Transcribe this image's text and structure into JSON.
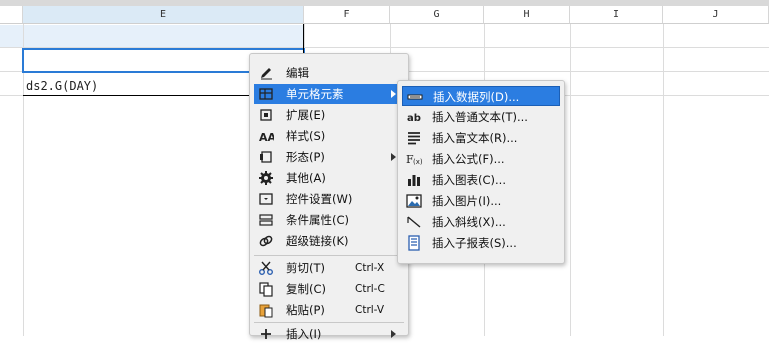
{
  "sheet": {
    "columns": [
      "E",
      "F",
      "G",
      "H",
      "I",
      "J"
    ],
    "cell_text": "ds2.G(DAY)"
  },
  "context_menu": {
    "items": [
      {
        "label": "编辑",
        "icon": "pencil-icon",
        "shortcut": "",
        "submenu": false
      },
      {
        "label": "单元格元素",
        "icon": "cell-element-icon",
        "shortcut": "",
        "submenu": true,
        "active": true
      },
      {
        "label": "扩展(E)",
        "icon": "expand-icon",
        "shortcut": "",
        "submenu": false
      },
      {
        "label": "样式(S)",
        "icon": "style-icon",
        "shortcut": "",
        "submenu": false
      },
      {
        "label": "形态(P)",
        "icon": "form-icon",
        "shortcut": "",
        "submenu": true
      },
      {
        "label": "其他(A)",
        "icon": "gear-icon",
        "shortcut": "",
        "submenu": false
      },
      {
        "label": "控件设置(W)",
        "icon": "widget-icon",
        "shortcut": "",
        "submenu": false
      },
      {
        "label": "条件属性(C)",
        "icon": "condition-icon",
        "shortcut": "",
        "submenu": false
      },
      {
        "label": "超级链接(K)",
        "icon": "link-icon",
        "shortcut": "",
        "submenu": false
      },
      {
        "label": "剪切(T)",
        "icon": "scissors-icon",
        "shortcut": "Ctrl-X",
        "submenu": false
      },
      {
        "label": "复制(C)",
        "icon": "copy-icon",
        "shortcut": "Ctrl-C",
        "submenu": false
      },
      {
        "label": "粘贴(P)",
        "icon": "paste-icon",
        "shortcut": "Ctrl-V",
        "submenu": false
      },
      {
        "label": "插入(I)",
        "icon": "plus-icon",
        "shortcut": "",
        "submenu": true
      }
    ]
  },
  "submenu": {
    "items": [
      {
        "label": "插入数据列(D)...",
        "icon": "data-column-icon",
        "active": true
      },
      {
        "label": "插入普通文本(T)...",
        "icon": "text-ab-icon"
      },
      {
        "label": "插入富文本(R)...",
        "icon": "rich-text-icon"
      },
      {
        "label": "插入公式(F)...",
        "icon": "formula-icon"
      },
      {
        "label": "插入图表(C)...",
        "icon": "chart-icon"
      },
      {
        "label": "插入图片(I)...",
        "icon": "image-icon"
      },
      {
        "label": "插入斜线(X)...",
        "icon": "slash-icon"
      },
      {
        "label": "插入子报表(S)...",
        "icon": "subreport-icon"
      }
    ]
  },
  "colors": {
    "accent": "#2b7de1",
    "selection": "#2a7bd6"
  }
}
